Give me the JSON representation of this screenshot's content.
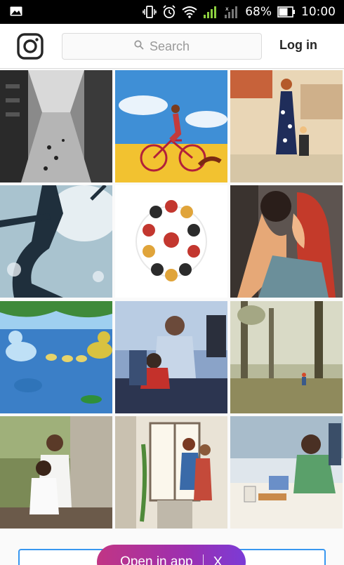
{
  "status_bar": {
    "battery_percent_label": "68%",
    "time": "10:00",
    "icons": [
      "gallery-icon",
      "vibrate-icon",
      "alarm-icon",
      "wifi-icon",
      "signal-icon",
      "signal-icon-2",
      "battery-icon"
    ]
  },
  "header": {
    "logo_icon": "instagram-logo-icon",
    "search_placeholder": "Search",
    "login_label": "Log in"
  },
  "grid": {
    "posts": [
      {
        "name": "post-city-street",
        "icon": "image"
      },
      {
        "name": "post-bike-ride",
        "icon": "image"
      },
      {
        "name": "post-market-walk",
        "icon": "image"
      },
      {
        "name": "post-pregnant-silhouette",
        "icon": "image"
      },
      {
        "name": "post-character-circle",
        "icon": "image"
      },
      {
        "name": "post-couple-kiss",
        "icon": "image"
      },
      {
        "name": "post-ducks-water",
        "icon": "image"
      },
      {
        "name": "post-father-child-desk",
        "icon": "image"
      },
      {
        "name": "post-forest-walk",
        "icon": "image"
      },
      {
        "name": "post-father-daughter-photo",
        "icon": "image"
      },
      {
        "name": "post-couple-window",
        "icon": "image"
      },
      {
        "name": "post-breakfast-table",
        "icon": "image"
      }
    ]
  },
  "open_app": {
    "label": "Open in app",
    "close_label": "X"
  },
  "colors": {
    "accent": "#3897f0",
    "gradient_start": "#c13584",
    "gradient_end": "#7b3bd6"
  }
}
